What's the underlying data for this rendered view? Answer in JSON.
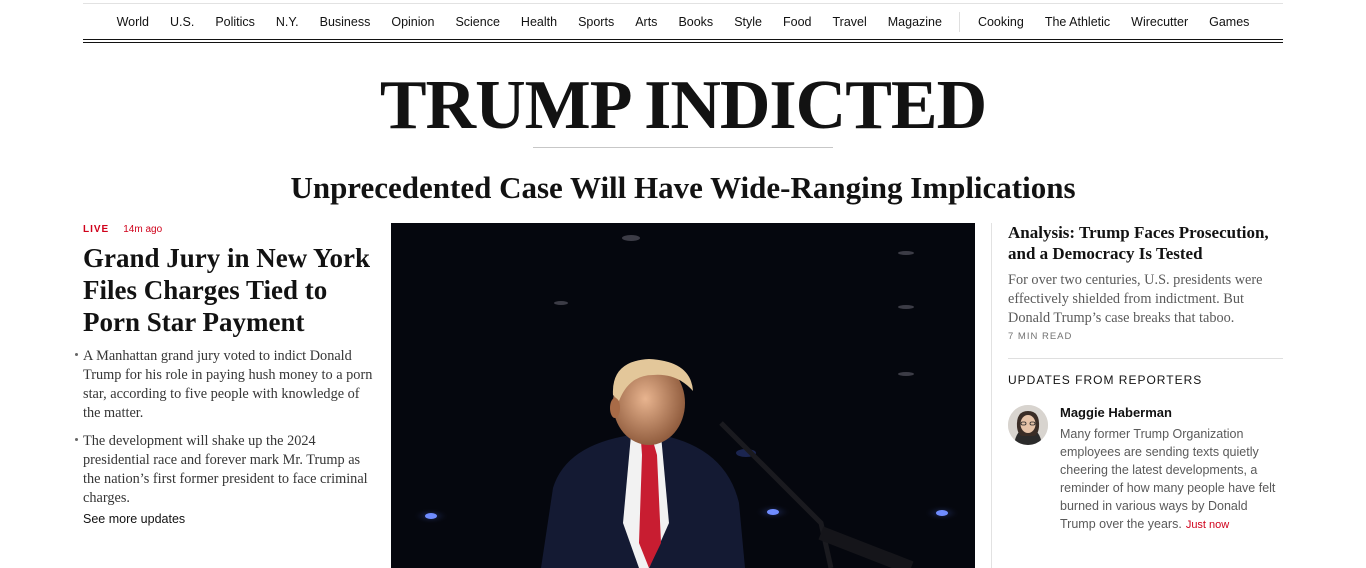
{
  "nav": {
    "sections": [
      "World",
      "U.S.",
      "Politics",
      "N.Y.",
      "Business",
      "Opinion",
      "Science",
      "Health",
      "Sports",
      "Arts",
      "Books",
      "Style",
      "Food",
      "Travel",
      "Magazine"
    ],
    "products": [
      "Cooking",
      "The Athletic",
      "Wirecutter",
      "Games"
    ]
  },
  "headline": "TRUMP INDICTED",
  "subheadline": "Unprecedented Case Will Have Wide-Ranging Implications",
  "lead_story": {
    "live_label": "LIVE",
    "timestamp": "14m ago",
    "title": "Grand Jury in New York Files Charges Tied to Porn Star Payment",
    "bullets": [
      "A Manhattan grand jury voted to indict Donald Trump for his role in paying hush money to a porn star, according to five people with knowledge of the matter.",
      "The development will shake up the 2024 presidential race and forever mark Mr. Trump as the nation’s first former president to face criminal charges."
    ],
    "see_more": "See more updates"
  },
  "analysis": {
    "title": "Analysis: Trump Faces Prosecution, and a Democracy Is Tested",
    "summary": "For over two centuries, U.S. presidents were effectively shielded from indictment. But Donald Trump’s case breaks that taboo.",
    "read_time": "7 MIN READ"
  },
  "updates": {
    "label": "UPDATES FROM REPORTERS",
    "reporter_name": "Maggie Haberman",
    "text": "Many former Trump Organization employees are sending texts quietly cheering the latest developments, a reminder of how many people have felt burned in various ways by Donald Trump over the years.",
    "time": "Just now"
  },
  "colors": {
    "live_red": "#d0021b",
    "text": "#121212",
    "photo_bg": "#05070e"
  }
}
